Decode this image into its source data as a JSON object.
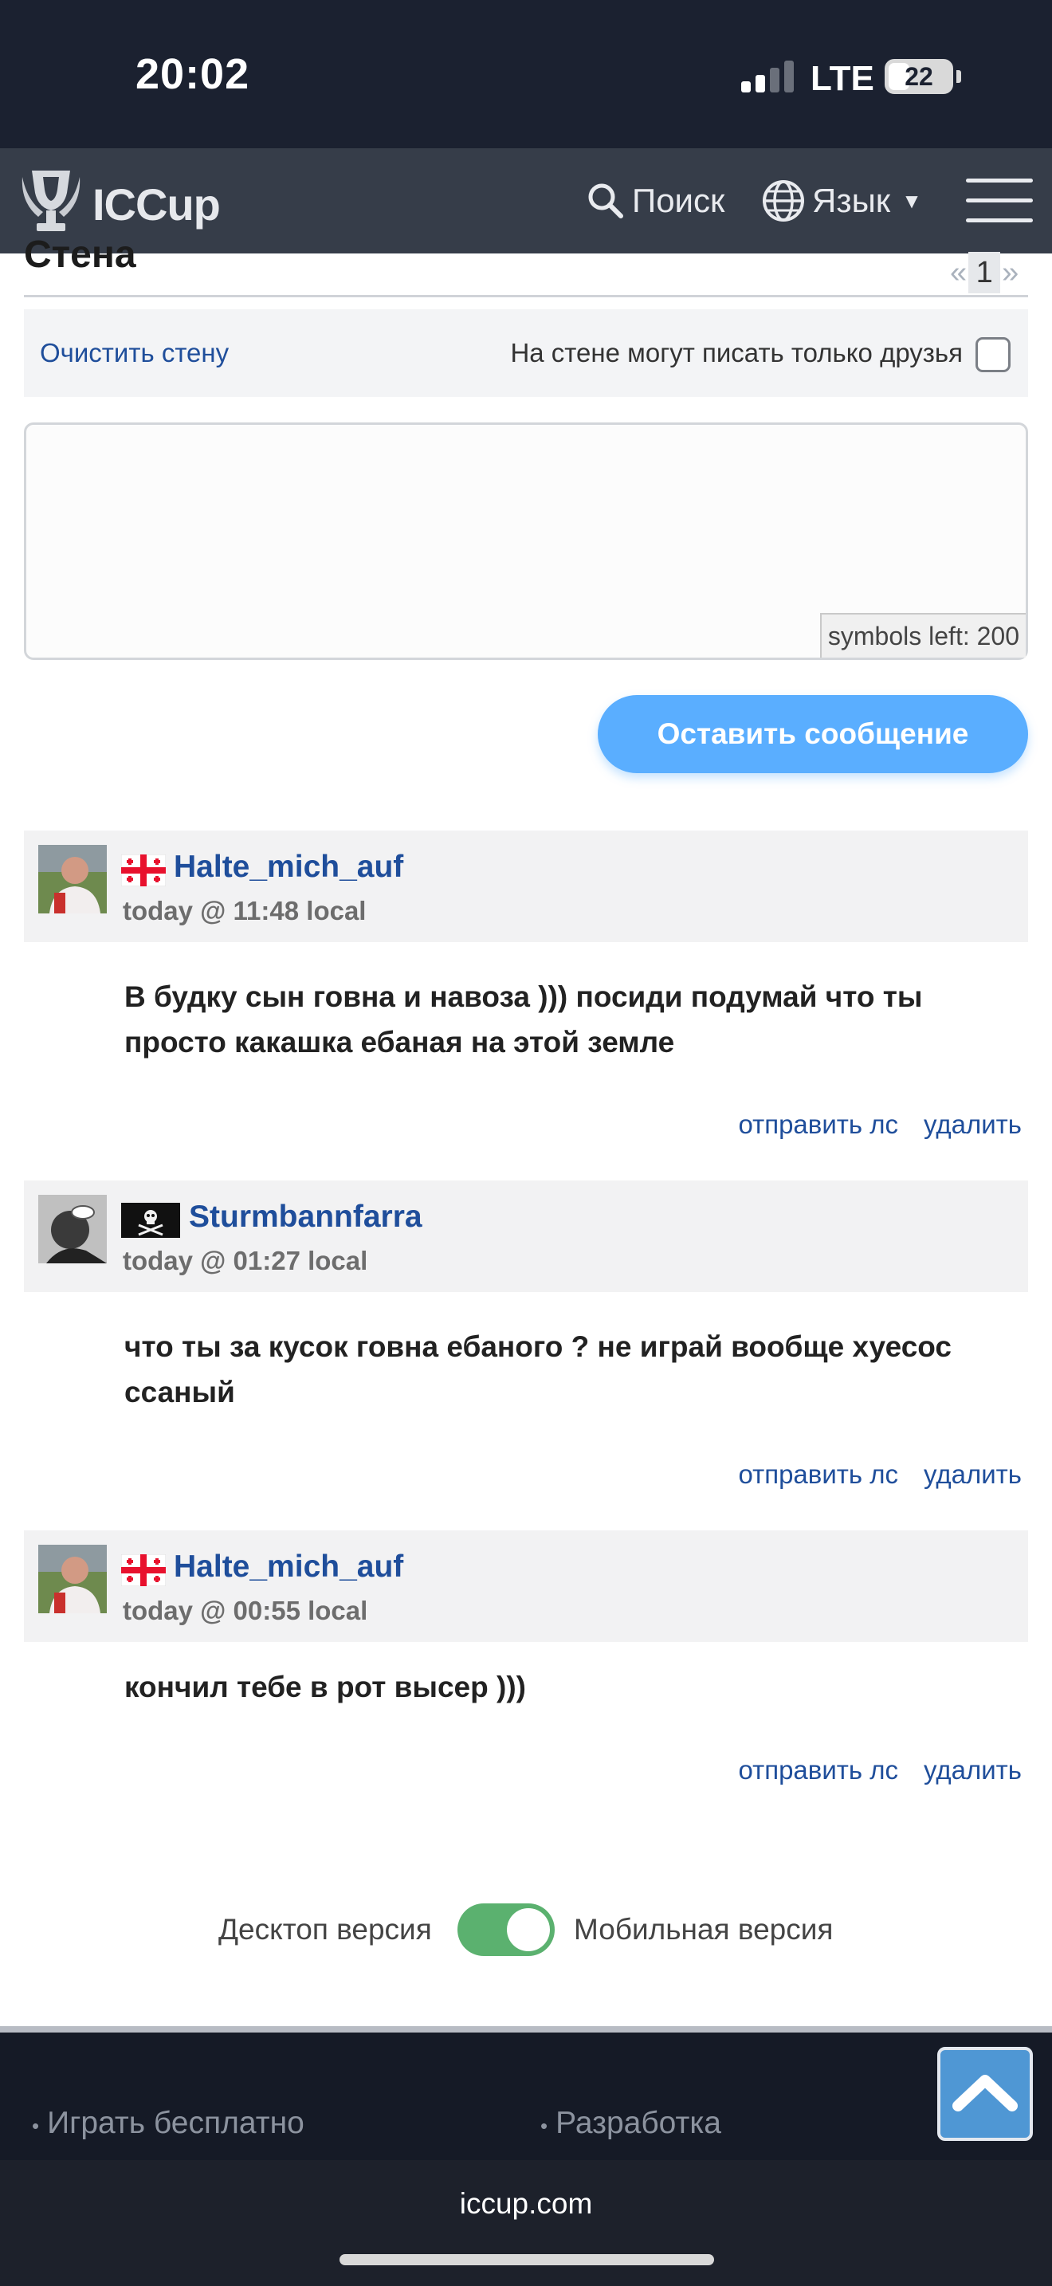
{
  "status_bar": {
    "time": "20:02",
    "network": "LTE",
    "battery": "22"
  },
  "nav": {
    "logo": "ICCup",
    "search_label": "Поиск",
    "language_label": "Язык"
  },
  "wall": {
    "title": "Стена",
    "pager": {
      "prev": "«",
      "current": "1",
      "next": "»"
    },
    "clear_label": "Очистить стену",
    "friends_only_label": "На стене могут писать только друзья",
    "symbols_left": "symbols left: 200",
    "post_button": "Оставить сообщение"
  },
  "posts": [
    {
      "username": "Halte_mich_auf",
      "flag": "georgia-flag",
      "time": "today @ 11:48 local",
      "text": "В будку сын говна и навоза ))) посиди подумай что ты просто какашка ебаная на этой земле",
      "action_message": "отправить лс",
      "action_delete": "удалить"
    },
    {
      "username": "Sturmbannfarra",
      "flag": "pirate-flag",
      "time": "today @ 01:27 local",
      "text": "что ты за кусок говна ебаного ? не играй вообще хуесос ссаный",
      "action_message": "отправить лс",
      "action_delete": "удалить"
    },
    {
      "username": "Halte_mich_auf",
      "flag": "georgia-flag",
      "time": "today @ 00:55 local",
      "text": "кончил тебе в рот высер )))",
      "action_message": "отправить лс",
      "action_delete": "удалить"
    }
  ],
  "version_toggle": {
    "desktop_label": "Десктоп версия",
    "mobile_label": "Мобильная версия",
    "mobile_enabled": true
  },
  "footer": {
    "links": [
      "Играть бесплатно",
      "Разработка"
    ],
    "bullet": "•"
  },
  "browser": {
    "url": "iccup.com"
  },
  "colors": {
    "accent": "#5aaeff",
    "link": "#1f4e9b",
    "navbar": "#363d49",
    "toggle_on": "#5bb16f"
  }
}
